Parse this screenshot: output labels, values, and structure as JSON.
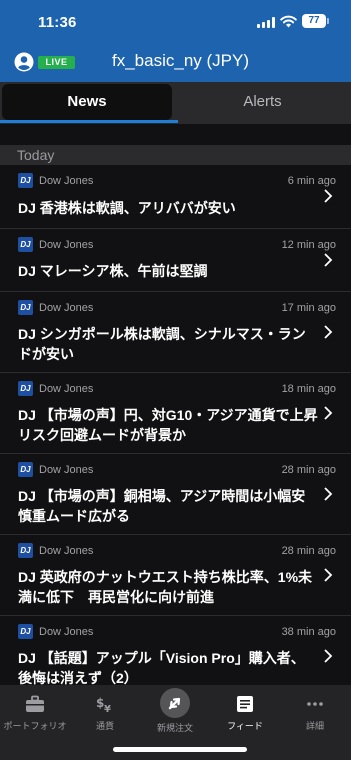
{
  "status_bar": {
    "time": "11:36",
    "battery": "77"
  },
  "header": {
    "live_badge": "LIVE",
    "title": "fx_basic_ny (JPY)"
  },
  "tabs": [
    {
      "label": "News"
    },
    {
      "label": "Alerts"
    }
  ],
  "section": {
    "label": "Today"
  },
  "news": [
    {
      "logo": "DJ",
      "source": "Dow Jones",
      "time": "6 min ago",
      "headline": "DJ  香港株は軟調、アリババが安い"
    },
    {
      "logo": "DJ",
      "source": "Dow Jones",
      "time": "12 min ago",
      "headline": "DJ  マレーシア株、午前は堅調"
    },
    {
      "logo": "DJ",
      "source": "Dow Jones",
      "time": "17 min ago",
      "headline": "DJ  シンガポール株は軟調、シナルマス・ランドが安い"
    },
    {
      "logo": "DJ",
      "source": "Dow Jones",
      "time": "18 min ago",
      "headline": "DJ  【市場の声】円、対G10・アジア通貨で上昇　リスク回避ムードが背景か"
    },
    {
      "logo": "DJ",
      "source": "Dow Jones",
      "time": "28 min ago",
      "headline": "DJ  【市場の声】銅相場、アジア時間は小幅安　慎重ムード広がる"
    },
    {
      "logo": "DJ",
      "source": "Dow Jones",
      "time": "28 min ago",
      "headline": "DJ  英政府のナットウエスト持ち株比率、1%未満に低下　再民営化に向け前進"
    },
    {
      "logo": "DJ",
      "source": "Dow Jones",
      "time": "38 min ago",
      "headline": "DJ  【話題】アップル「Vision Pro」購入者、後悔は消えず（2）"
    }
  ],
  "bottom_nav": [
    {
      "label": "ポートフォリオ",
      "icon": "briefcase-icon"
    },
    {
      "label": "通貨",
      "icon": "currency-icon"
    },
    {
      "label": "新規注文",
      "icon": "new-order-icon"
    },
    {
      "label": "フィード",
      "icon": "feed-icon"
    },
    {
      "label": "詳細",
      "icon": "more-icon"
    }
  ],
  "colors": {
    "header": "#1e63ad",
    "live": "#25b04d",
    "accent": "#1e7fd6",
    "background": "#111113"
  }
}
